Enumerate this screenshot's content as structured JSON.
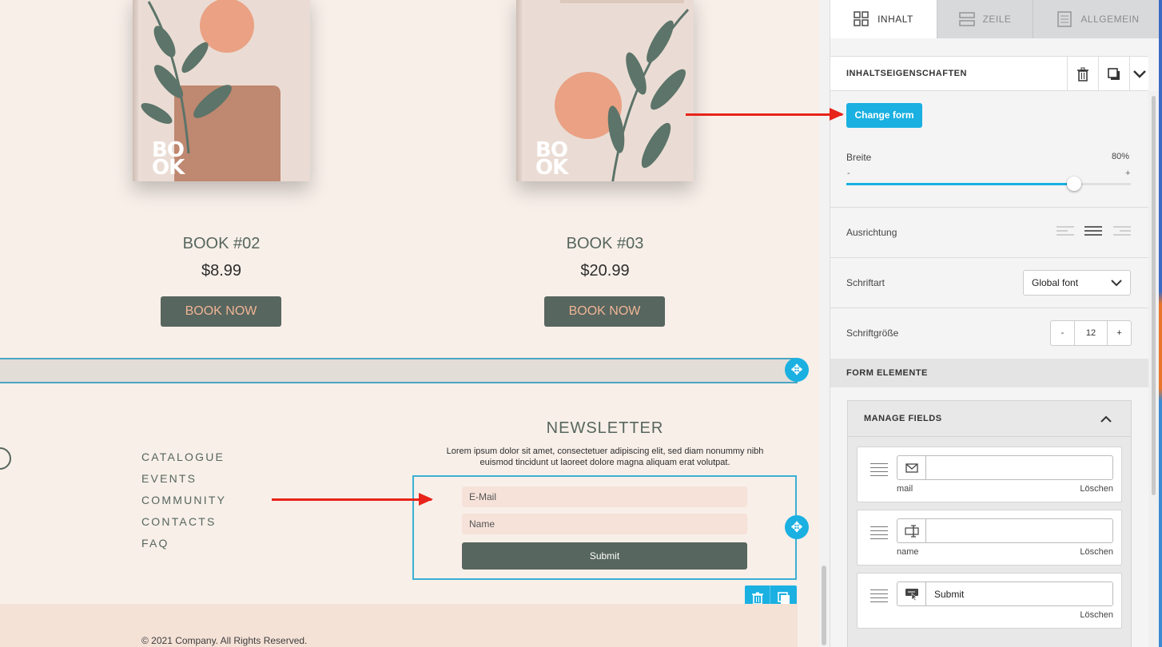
{
  "books": [
    {
      "title": "BOOK #02",
      "price": "$8.99",
      "button": "BOOK NOW",
      "logo": "BO OK"
    },
    {
      "title": "BOOK #03",
      "price": "$20.99",
      "button": "BOOK NOW",
      "logo": "BO OK"
    }
  ],
  "footer": {
    "links": [
      "CATALOGUE",
      "EVENTS",
      "COMMUNITY",
      "CONTACTS",
      "FAQ"
    ],
    "copyright": "© 2021 Company. All Rights Reserved."
  },
  "newsletter": {
    "title": "NEWSLETTER",
    "text": "Lorem ipsum dolor sit amet, consectetuer adipiscing elit, sed diam nonummy nibh euismod tincidunt ut laoreet dolore magna aliquam erat volutpat.",
    "email_placeholder": "E-Mail",
    "name_placeholder": "Name",
    "submit": "Submit"
  },
  "panel": {
    "tabs": [
      {
        "label": "INHALT",
        "icon": "grid-icon"
      },
      {
        "label": "ZEILE",
        "icon": "rows-icon"
      },
      {
        "label": "ALLGEMEIN",
        "icon": "document-icon"
      }
    ],
    "properties_title": "INHALTSEIGENSCHAFTEN",
    "change_form": "Change form",
    "width_label": "Breite",
    "width_value": "80%",
    "width_fraction": 0.8,
    "minus": "-",
    "plus": "+",
    "alignment_label": "Ausrichtung",
    "font_label": "Schriftart",
    "font_value": "Global font",
    "font_size_label": "Schriftgröße",
    "font_size_value": "12",
    "form_elements_title": "FORM ELEMENTE",
    "manage_fields_title": "MANAGE FIELDS",
    "fields": [
      {
        "icon": "mail-icon",
        "value": "",
        "name": "mail",
        "delete": "Löschen"
      },
      {
        "icon": "text-cursor-icon",
        "value": "",
        "name": "name",
        "delete": "Löschen"
      },
      {
        "icon": "button-icon",
        "value": "Submit",
        "name": "",
        "delete": "Löschen"
      }
    ]
  },
  "colors": {
    "accent": "#1ab0e1",
    "sage": "#57665e",
    "peach": "#f0b496",
    "arrow": "#e8231a"
  }
}
